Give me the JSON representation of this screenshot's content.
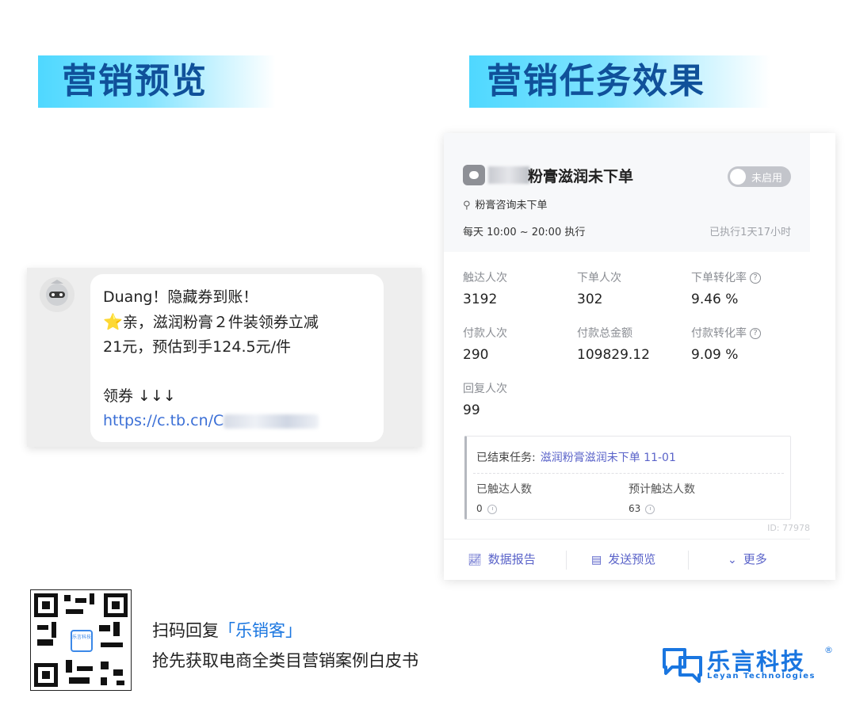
{
  "banners": {
    "left": "营销预览",
    "right": "营销任务效果"
  },
  "sms": {
    "line1": "Duang！隐藏券到账！",
    "line2": "亲，滋润粉膏２件装领券立减",
    "line3": "21元，预估到手124.5元/件",
    "line4": "领券 ↓↓↓",
    "link_prefix": "https://c.tb.cn/C",
    "star_icon": "star-icon"
  },
  "task": {
    "name": "粉膏滋润未下单",
    "status": "未启用",
    "subtitle": "粉膏咨询未下单",
    "schedule": "每天 10:00 ~ 20:00 执行",
    "executed": "已执行1天17小时",
    "stats": [
      {
        "label": "触达人次",
        "value": "3192"
      },
      {
        "label": "下单人次",
        "value": "302"
      },
      {
        "label": "下单转化率",
        "value": "9.46 %",
        "help": true
      },
      {
        "label": "付款人次",
        "value": "290"
      },
      {
        "label": "付款总金额",
        "value": "109829.12"
      },
      {
        "label": "付款转化率",
        "value": "9.09 %",
        "help": true
      },
      {
        "label": "回复人次",
        "value": "99"
      }
    ],
    "ended": {
      "prefix": "已结束任务:",
      "name": "滋润粉膏滋润未下单 11-01",
      "reached_label": "已触达人数",
      "reached_value": "0",
      "expected_label": "预计触达人数",
      "expected_value": "63"
    },
    "id": "ID: 77978",
    "footer": {
      "report": "数据报告",
      "preview": "发送预览",
      "more": "更多"
    }
  },
  "cta": {
    "line1_prefix": "扫码回复",
    "line1_brand": "「乐销客」",
    "line2": "抢先获取电商全类目营销案例白皮书",
    "qr_logo": "乐言科技"
  },
  "logo": {
    "name": "乐言科技",
    "reg": "®",
    "sub": "Leyan Technologies"
  }
}
